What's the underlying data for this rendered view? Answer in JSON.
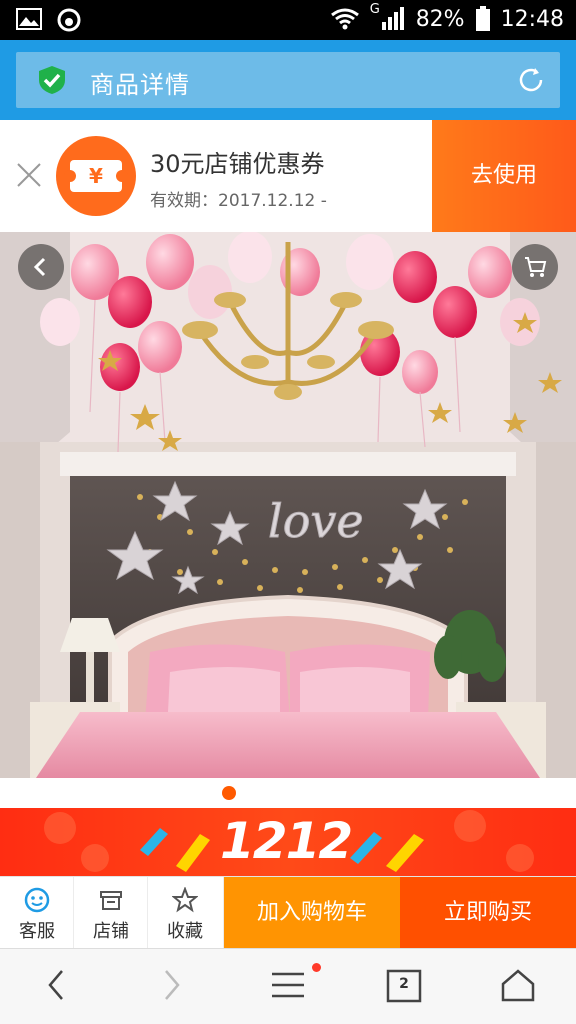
{
  "status_bar": {
    "network": "G",
    "battery": "82%",
    "time": "12:48"
  },
  "header": {
    "title": "商品详情",
    "icons": [
      "shield-check-icon",
      "refresh-icon"
    ],
    "color": "#1f9be4"
  },
  "coupon": {
    "title": "30元店铺优惠券",
    "validity": "有效期：2017.12.12 -",
    "use_label": "去使用",
    "yen_symbol": "¥",
    "accent": "#ff6b1c"
  },
  "hero": {
    "love_text": "love",
    "page_indicator": {
      "current": 1,
      "total": 1
    }
  },
  "banner": {
    "text": "1212"
  },
  "action_bar": {
    "service_label": "客服",
    "shop_label": "店铺",
    "favorite_label": "收藏",
    "add_to_cart_label": "加入购物车",
    "buy_now_label": "立即购买",
    "add_to_cart_color": "#ff9402",
    "buy_now_color": "#ff5000"
  },
  "browser_nav": {
    "tab_count": "2"
  }
}
